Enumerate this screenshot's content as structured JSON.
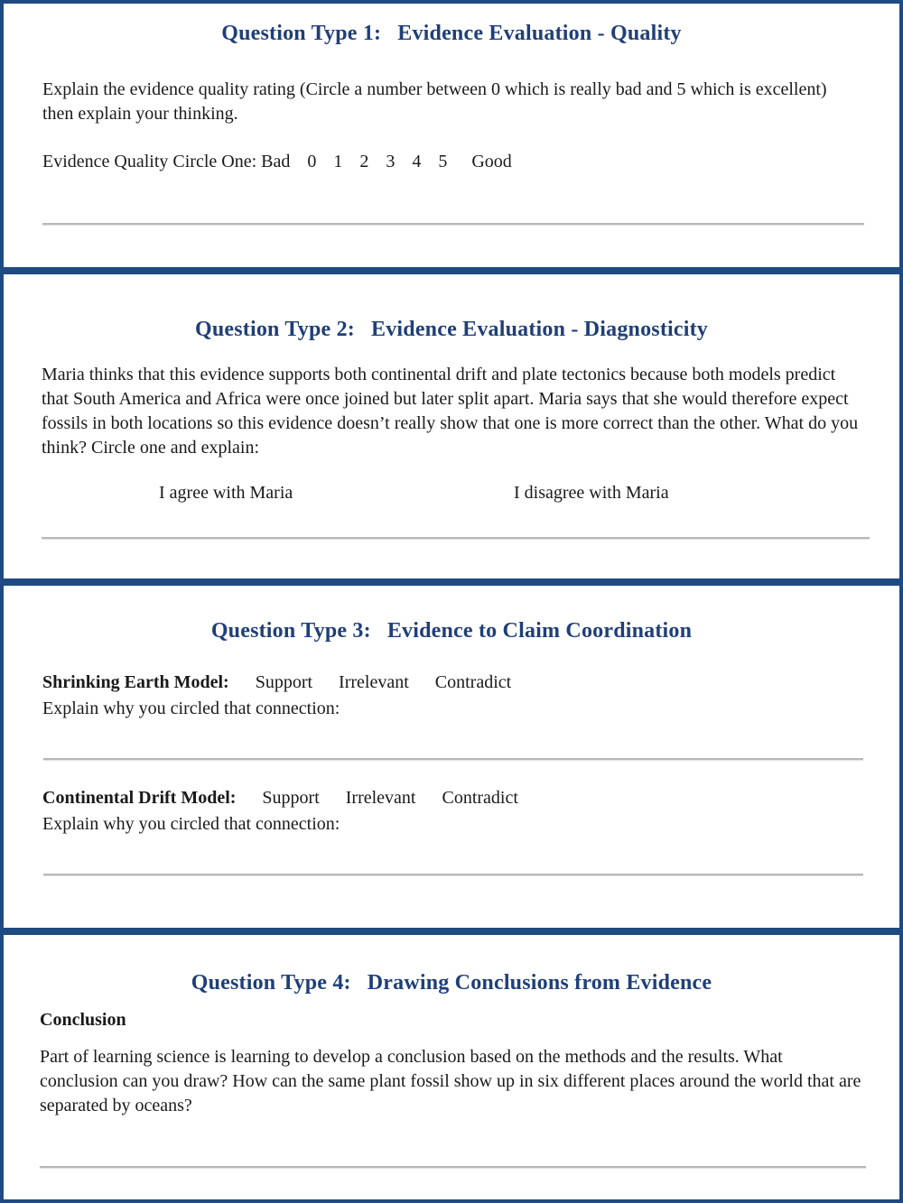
{
  "colors": {
    "accent": "#1f4a82",
    "heading": "#1f3f78",
    "rule": "#b8b8b8"
  },
  "sections": [
    {
      "heading_num": "Question Type 1:",
      "heading_title": "Evidence Evaluation - Quality",
      "instructions": "Explain the evidence quality rating (Circle a number between 0 which is really bad and 5 which is excellent) then explain your thinking.",
      "scale": {
        "label": "Evidence Quality Circle One: Bad",
        "options": [
          "0",
          "1",
          "2",
          "3",
          "4",
          "5"
        ],
        "end_label": "Good"
      }
    },
    {
      "heading_num": "Question Type 2:",
      "heading_title": "Evidence Evaluation - Diagnosticity",
      "prompt": "Maria thinks that this evidence supports both continental drift and plate tectonics because both models predict that South America and Africa were once joined but later split apart. Maria says that she would therefore expect fossils in both locations so this evidence doesn’t really show that one is more correct than the other. What do you think?   Circle one and explain:",
      "choices": [
        "I agree with Maria",
        "I disagree with Maria"
      ]
    },
    {
      "heading_num": "Question Type 3:",
      "heading_title": "Evidence to Claim Coordination",
      "models": [
        {
          "label": "Shrinking Earth Model:",
          "options": [
            "Support",
            "Irrelevant",
            "Contradict"
          ],
          "explain": "Explain why you circled that connection:"
        },
        {
          "label": "Continental Drift Model:",
          "options": [
            "Support",
            "Irrelevant",
            "Contradict"
          ],
          "explain": "Explain why you circled that connection:"
        }
      ]
    },
    {
      "heading_num": "Question Type 4:",
      "heading_title": "Drawing Conclusions from Evidence",
      "sublabel": "Conclusion",
      "prompt": "Part of learning science is learning to develop a conclusion based on the methods and the results. What conclusion can you draw? How can the same plant fossil show up in six different places around the world that are separated by oceans?"
    }
  ]
}
